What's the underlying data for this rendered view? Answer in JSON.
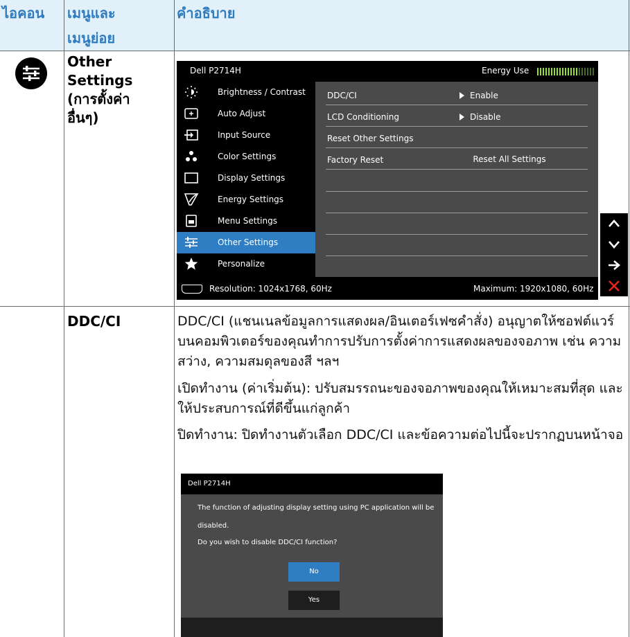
{
  "table": {
    "col_icon": "ไอคอน",
    "col_menu_line1": "เมนูและ",
    "col_menu_line2": "เมนูย่อย",
    "col_description": "คำอธิบาย",
    "row1_label": [
      "Other",
      "Settings",
      "(การตั้งค่า",
      "อื่นๆ)"
    ],
    "row2_label": "DDC/CI"
  },
  "osd": {
    "model": "Dell P2714H",
    "energy_label": "Energy Use",
    "menu": [
      {
        "label": "Brightness / Contrast",
        "icon": "brightness-icon"
      },
      {
        "label": "Auto Adjust",
        "icon": "auto-adjust-icon"
      },
      {
        "label": "Input Source",
        "icon": "input-source-icon"
      },
      {
        "label": "Color Settings",
        "icon": "color-settings-icon"
      },
      {
        "label": "Display Settings",
        "icon": "display-settings-icon"
      },
      {
        "label": "Energy Settings",
        "icon": "energy-settings-icon"
      },
      {
        "label": "Menu Settings",
        "icon": "menu-settings-icon"
      },
      {
        "label": "Other Settings",
        "icon": "other-settings-icon",
        "active": true
      },
      {
        "label": "Personalize",
        "icon": "star-icon"
      }
    ],
    "rows": [
      {
        "label": "DDC/CI",
        "value": "Enable"
      },
      {
        "label": "LCD Conditioning",
        "value": "Disable"
      },
      {
        "label": "Reset Other Settings",
        "value": ""
      },
      {
        "label": "Factory Reset",
        "value": "Reset All Settings"
      }
    ],
    "resolution": "Resolution: 1024x1768, 60Hz",
    "maximum": "Maximum: 1920x1080, 60Hz",
    "nav": [
      "up-arrow-icon",
      "down-arrow-icon",
      "right-arrow-icon",
      "close-icon"
    ]
  },
  "description": {
    "para1": "DDC/CI (แชนเนลข้อมูลการแสดงผล/อินเตอร์เฟซคำสั่ง) อนุญาตให้ซอฟต์แวร์บนคอมพิวเตอร์ของคุณทำการปรับการตั้งค่าการแสดงผลของจอภาพ เช่น ความสว่าง, ความสมดุลของสี ฯลฯ",
    "para2": "เปิดทำงาน (ค่าเริ่มต้น): ปรับสมรรถนะของจอภาพของคุณให้เหมาะสมที่สุด และให้ประสบการณ์ที่ดีขึ้นแก่ลูกค้า",
    "para3": "ปิดทำงาน: ปิดทำงานตัวเลือก DDC/CI และข้อความต่อไปนี้จะปรากฏบนหน้าจอ"
  },
  "dialog": {
    "title": "Dell P2714H",
    "line1": "The function of adjusting display setting using PC application will be",
    "line2": "disabled.",
    "line3": "Do you wish to disable DDC/CI function?",
    "no": "No",
    "yes": "Yes"
  },
  "colors": {
    "accent": "#2f7ec3",
    "header_text": "#2e7bbf",
    "header_bg": "#e1f0f9",
    "energy_meter": "#9ae22a",
    "close": "#e0251b"
  }
}
